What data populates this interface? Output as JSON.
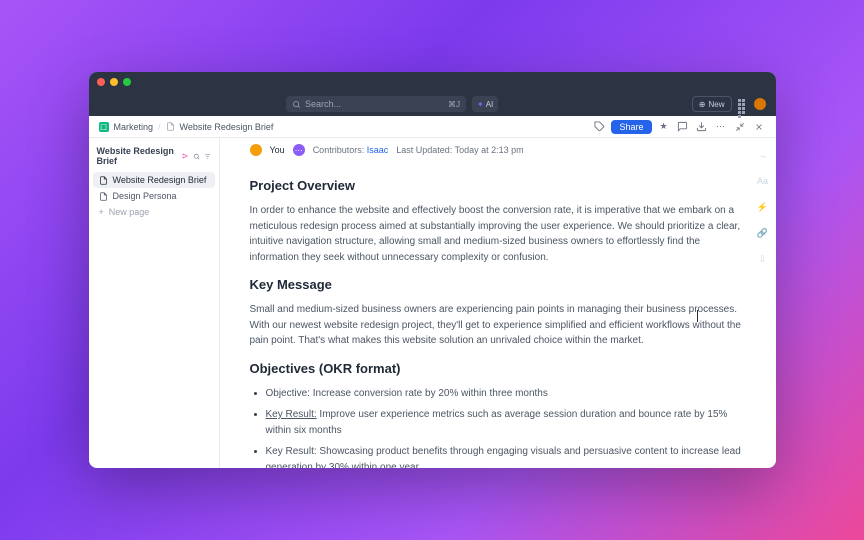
{
  "titlebar": {},
  "topbar": {
    "search_placeholder": "Search...",
    "search_kbd": "⌘J",
    "ai_label": "AI",
    "new_label": "New"
  },
  "breadcrumb": {
    "root": "Marketing",
    "page": "Website Redesign Brief",
    "share_label": "Share"
  },
  "sidebar": {
    "title": "Website Redesign Brief",
    "items": [
      {
        "label": "Website Redesign Brief",
        "active": true
      },
      {
        "label": "Design Persona",
        "active": false
      }
    ],
    "new_page": "New page"
  },
  "meta": {
    "you": "You",
    "contributors_label": "Contributors:",
    "contributors_value": "Isaac",
    "updated_label": "Last Updated:",
    "updated_value": "Today at 2:13 pm"
  },
  "content": {
    "h1": "Project Overview",
    "p1": "In order to enhance the website and effectively boost the conversion rate, it is imperative that we embark on a meticulous redesign process aimed at substantially improving the user experience. We should prioritize a clear, intuitive navigation structure, allowing small and medium-sized business owners to effortlessly find the information they seek without unnecessary complexity or confusion.",
    "h2": "Key Message",
    "p2": "Small and medium-sized business owners are experiencing pain points in managing their business processes. With our newest website redesign project, they'll get to experience simplified and efficient workflows without the pain point. That's what makes this website solution an unrivaled choice within the market.",
    "h3": "Objectives (OKR format)",
    "li1": "Objective: Increase conversion rate by 20% within three months",
    "li2_kr": "Key Result:",
    "li2_rest": " Improve user experience metrics such as average session duration and bounce rate by 15% within six months",
    "li3": "Key Result: Showcasing product benefits through engaging visuals and persuasive content to increase lead generation by 30% within one year"
  },
  "rail": {
    "aa": "Aa"
  }
}
